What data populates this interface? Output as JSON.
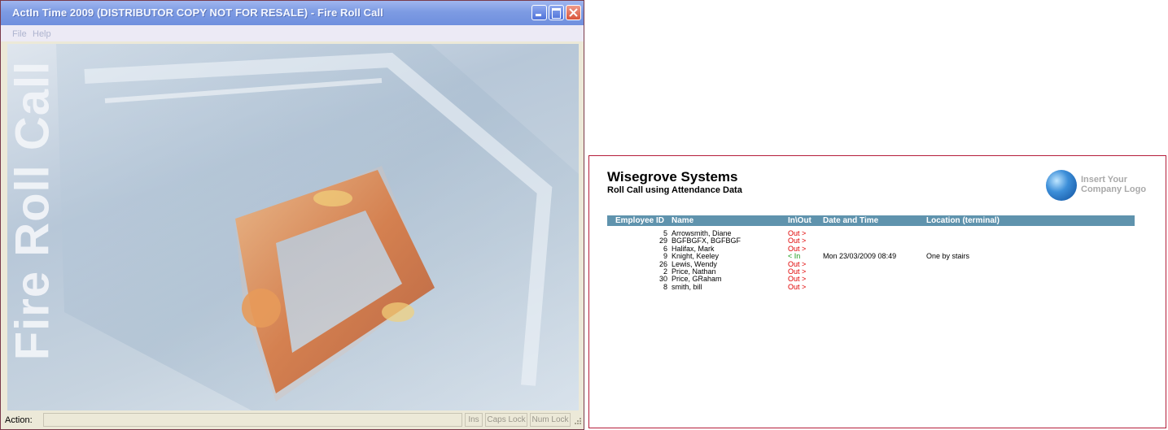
{
  "window": {
    "title": "ActIn Time 2009 (DISTRIBUTOR COPY NOT FOR RESALE) - Fire Roll Call",
    "menu": [
      "File",
      "Help"
    ],
    "vertical_title": "Fire Roll Call",
    "status": {
      "action_label": "Action:",
      "action_value": "",
      "panes": [
        "Ins",
        "Caps Lock",
        "Num Lock"
      ]
    }
  },
  "report": {
    "company": "Wisegrove Systems",
    "subtitle": "Roll Call using Attendance Data",
    "logo_text": [
      "Insert Your",
      "Company Logo"
    ],
    "columns": {
      "id": "Employee ID",
      "name": "Name",
      "inout": "In\\Out",
      "datetime": "Date and Time",
      "location": "Location (terminal)"
    },
    "rows": [
      {
        "id": "5",
        "name": "Arrowsmith, Diane",
        "status": "Out >",
        "state": "out",
        "datetime": "",
        "location": ""
      },
      {
        "id": "29",
        "name": "BGFBGFX, BGFBGF",
        "status": "Out >",
        "state": "out",
        "datetime": "",
        "location": ""
      },
      {
        "id": "6",
        "name": "Halifax, Mark",
        "status": "Out >",
        "state": "out",
        "datetime": "",
        "location": ""
      },
      {
        "id": "9",
        "name": "Knight, Keeley",
        "status": "< In",
        "state": "in",
        "datetime": "Mon 23/03/2009  08:49",
        "location": "One by stairs"
      },
      {
        "id": "26",
        "name": "Lewis, Wendy",
        "status": "Out >",
        "state": "out",
        "datetime": "",
        "location": ""
      },
      {
        "id": "2",
        "name": "Price, Nathan",
        "status": "Out >",
        "state": "out",
        "datetime": "",
        "location": ""
      },
      {
        "id": "30",
        "name": "Price, GRaham",
        "status": "Out >",
        "state": "out",
        "datetime": "",
        "location": ""
      },
      {
        "id": "8",
        "name": "smith, bill",
        "status": "Out >",
        "state": "out",
        "datetime": "",
        "location": ""
      }
    ]
  },
  "colors": {
    "titlebar": "#7d9be3",
    "report_header": "#5f93ad",
    "out": "#e00000",
    "in": "#1a9a1a",
    "report_border": "#b51d3a"
  }
}
